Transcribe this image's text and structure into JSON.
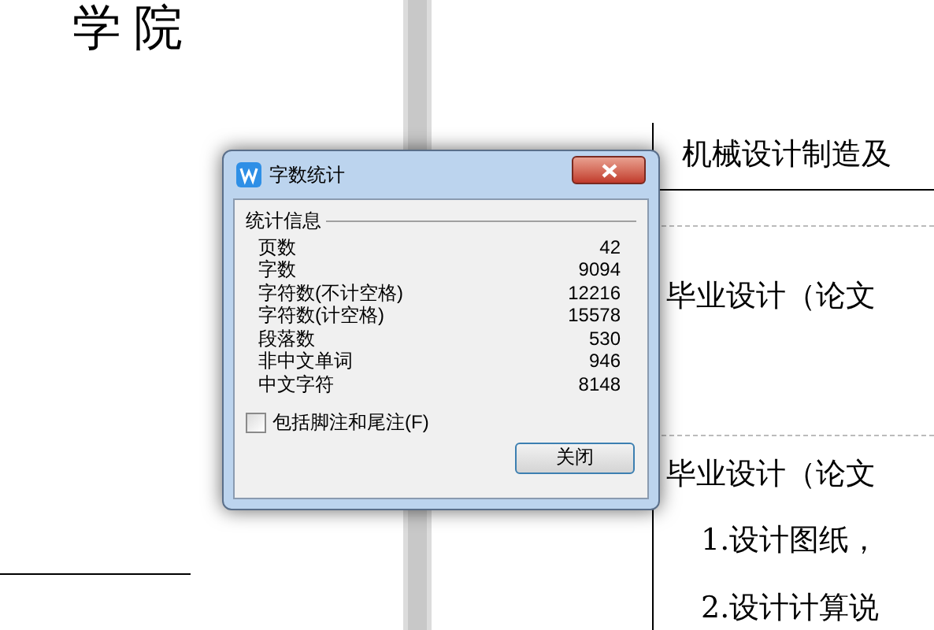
{
  "document": {
    "left_page": {
      "heading": "学院"
    },
    "right_page": {
      "rows": [
        "机械设计制造及",
        "毕业设计（论文",
        "毕业设计（论文"
      ],
      "list_items": [
        "1.设计图纸，",
        "2.设计计算说"
      ]
    }
  },
  "dialog": {
    "title": "字数统计",
    "group_label": "统计信息",
    "stats": [
      {
        "label": "页数",
        "value": "42"
      },
      {
        "label": "字数",
        "value": "9094"
      },
      {
        "label": "字符数(不计空格)",
        "value": "12216"
      },
      {
        "label": "字符数(计空格)",
        "value": "15578"
      },
      {
        "label": "段落数",
        "value": "530"
      },
      {
        "label": "非中文单词",
        "value": "946"
      },
      {
        "label": "中文字符",
        "value": "8148"
      }
    ],
    "include_notes": {
      "label": "包括脚注和尾注(F)",
      "checked": false
    },
    "close_button": "关闭"
  }
}
